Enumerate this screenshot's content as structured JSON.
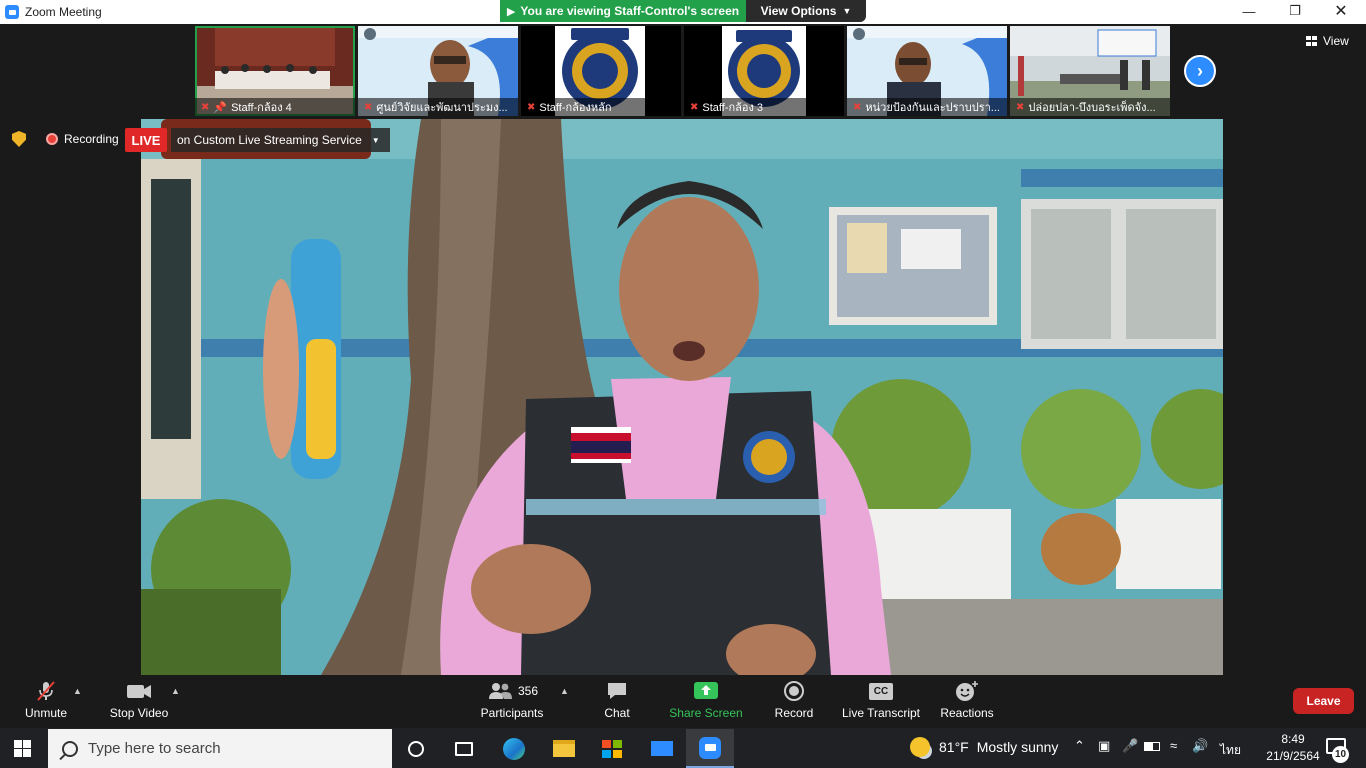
{
  "window": {
    "title": "Zoom Meeting",
    "viewing_banner": "You are viewing Staff-Control's screen",
    "view_options": "View Options",
    "view_label": "View"
  },
  "thumbnails": [
    {
      "name": "Staff-กล้อง 4",
      "muted": true,
      "pinned": true,
      "active": true
    },
    {
      "name": "ศูนย์วิจัยและพัฒนาประมง...",
      "muted": true
    },
    {
      "name": "Staff-กล้องหลัก",
      "muted": true
    },
    {
      "name": "Staff-กล้อง 3",
      "muted": true
    },
    {
      "name": "หน่วยป้องกันและปราบปรา...",
      "muted": true
    },
    {
      "name": "ปล่อยปลา-บึงบอระเพ็ดจัง...",
      "muted": true
    }
  ],
  "recording": {
    "label": "Recording",
    "live": "LIVE",
    "stream": "on Custom Live Streaming Service"
  },
  "toolbar": {
    "unmute": "Unmute",
    "stop_video": "Stop Video",
    "participants": "Participants",
    "participant_count": "356",
    "chat": "Chat",
    "share_screen": "Share Screen",
    "record": "Record",
    "live_transcript": "Live Transcript",
    "cc": "CC",
    "reactions": "Reactions",
    "leave": "Leave"
  },
  "taskbar": {
    "search_placeholder": "Type here to search",
    "temperature": "81°F",
    "weather": "Mostly sunny",
    "language": "ไทย",
    "time": "8:49",
    "date": "21/9/2564",
    "notifications": "10"
  },
  "colors": {
    "zoom_blue": "#2d8cff",
    "banner_green": "#23a04a",
    "live_red": "#e02828",
    "leave_red": "#c92424",
    "share_green": "#34c459"
  }
}
